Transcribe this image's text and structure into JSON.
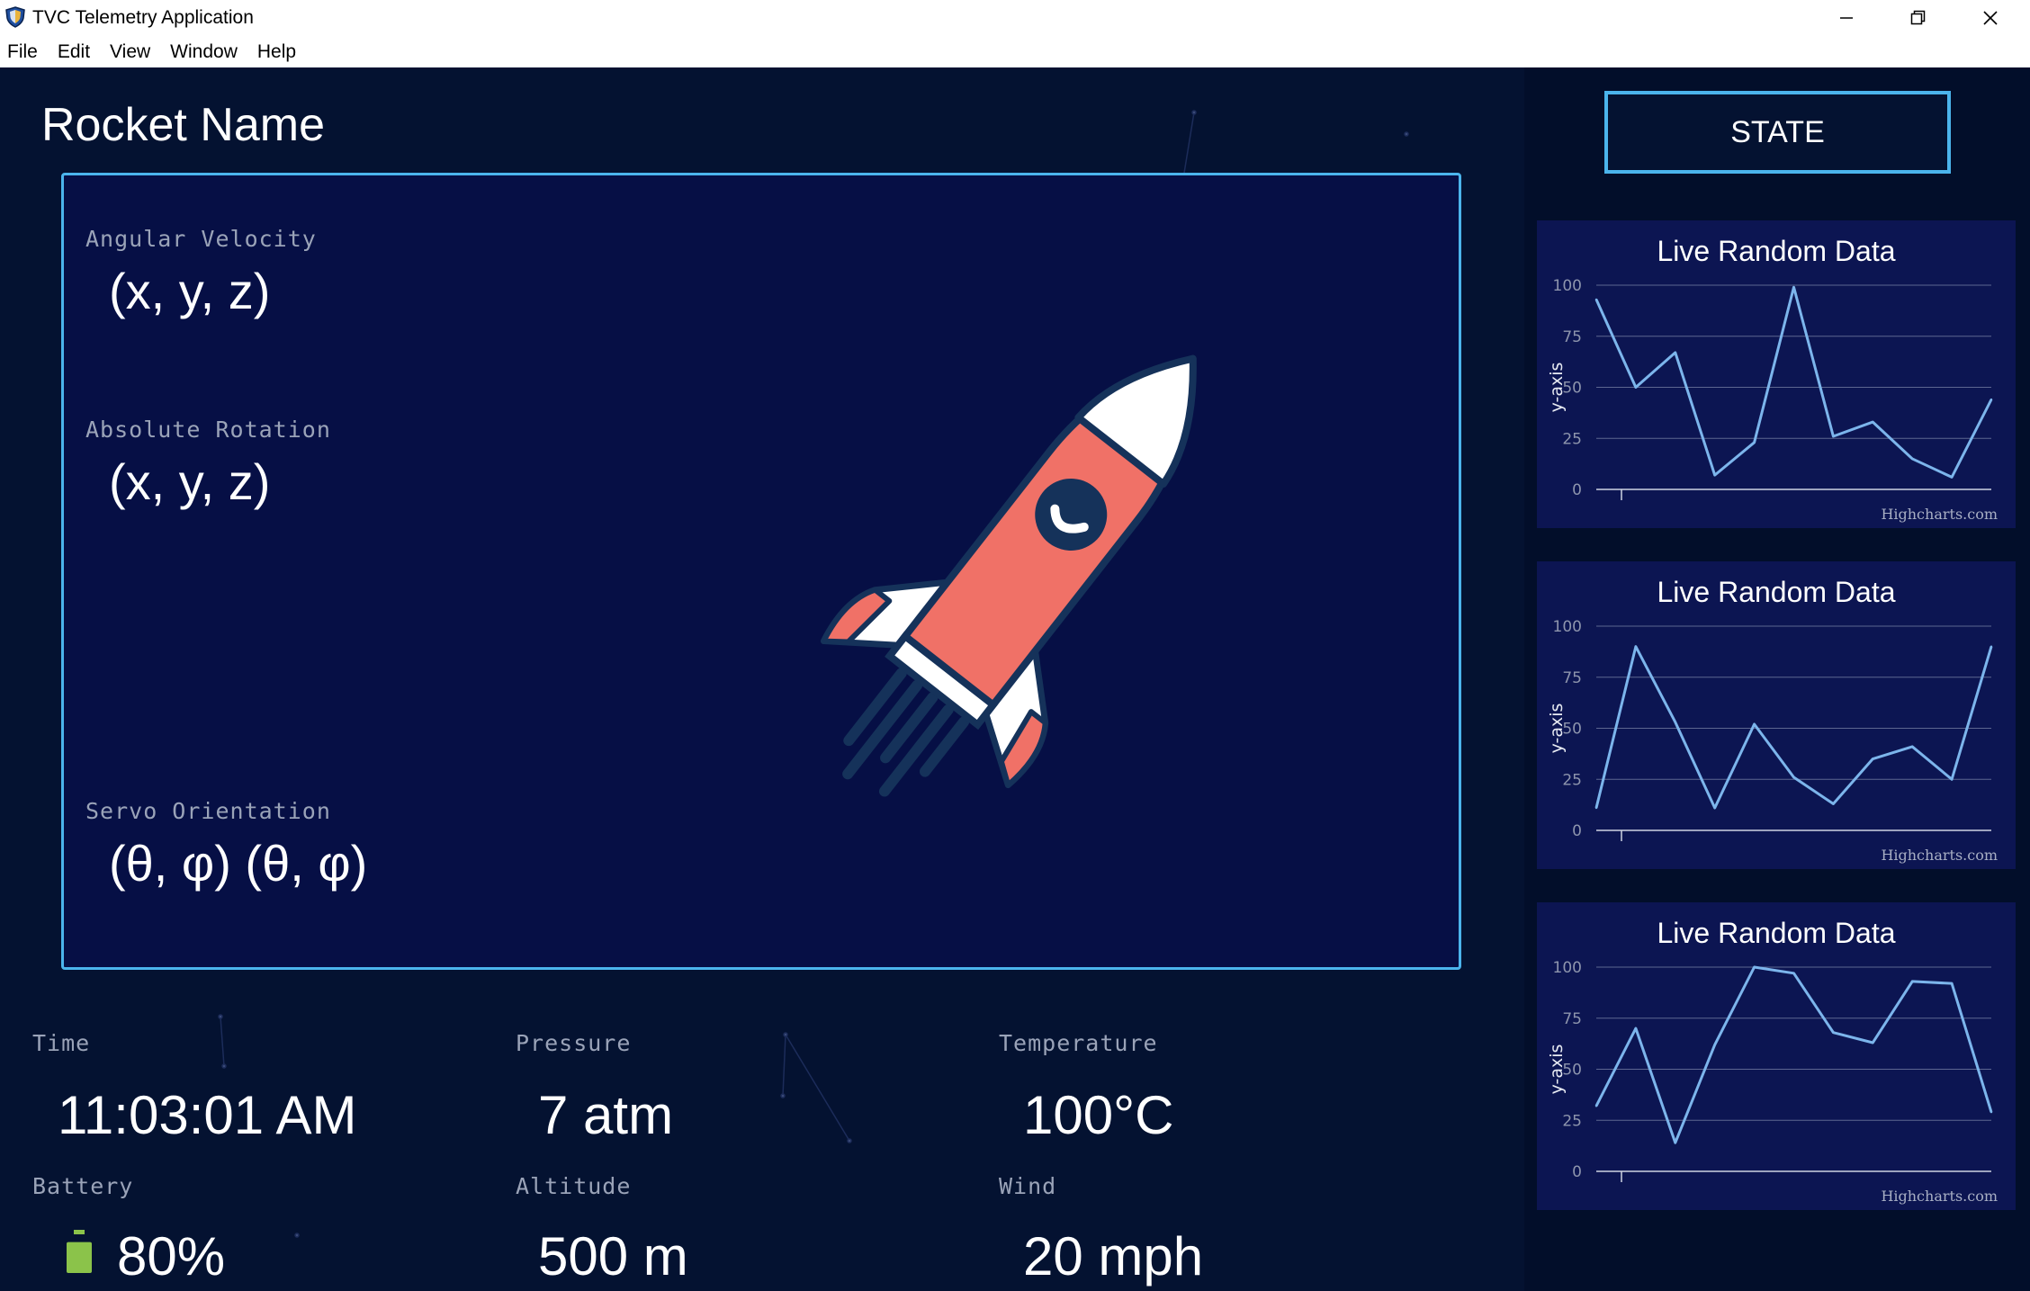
{
  "window": {
    "title": "TVC Telemetry Application",
    "controls": [
      "minimize",
      "restore",
      "close"
    ]
  },
  "menu": {
    "items": [
      "File",
      "Edit",
      "View",
      "Window",
      "Help"
    ]
  },
  "main": {
    "rocket_name": "Rocket Name",
    "panel": {
      "angular_velocity": {
        "label": "Angular Velocity",
        "value": "(x, y, z)"
      },
      "absolute_rotation": {
        "label": "Absolute Rotation",
        "value": "(x, y, z)"
      },
      "servo_orientation": {
        "label": "Servo Orientation",
        "value": "(θ, φ) (θ, φ)"
      }
    },
    "stats": {
      "time": {
        "label": "Time",
        "value": "11:03:01 AM"
      },
      "pressure": {
        "label": "Pressure",
        "value": "7 atm"
      },
      "temperature": {
        "label": "Temperature",
        "value": "100°C"
      },
      "battery": {
        "label": "Battery",
        "value": "80%",
        "level": 0.8
      },
      "altitude": {
        "label": "Altitude",
        "value": "500 m"
      },
      "wind": {
        "label": "Wind",
        "value": "20 mph"
      }
    }
  },
  "sidebar": {
    "state_button": "STATE"
  },
  "colors": {
    "background": "#041231",
    "panel": "#060f45",
    "accent": "#4bb4ec",
    "chart_line": "#7cb5ec",
    "rocket_body": "#f07167",
    "rocket_dark": "#15325a",
    "battery": "#8bc34a"
  },
  "chart_data": [
    {
      "type": "line",
      "title": "Live Random Data",
      "ylabel": "y-axis",
      "ylim": [
        0,
        100
      ],
      "yticks": [
        0,
        25,
        50,
        75,
        100
      ],
      "series": [
        {
          "values": [
            93,
            50,
            67,
            7,
            23,
            99,
            26,
            33,
            15,
            6,
            44
          ]
        }
      ],
      "credit": "Highcharts.com",
      "grid": true
    },
    {
      "type": "line",
      "title": "Live Random Data",
      "ylabel": "y-axis",
      "ylim": [
        0,
        100
      ],
      "yticks": [
        0,
        25,
        50,
        75,
        100
      ],
      "series": [
        {
          "values": [
            11,
            90,
            53,
            11,
            52,
            26,
            13,
            35,
            41,
            25,
            90
          ]
        }
      ],
      "credit": "Highcharts.com",
      "grid": true
    },
    {
      "type": "line",
      "title": "Live Random Data",
      "ylabel": "y-axis",
      "ylim": [
        0,
        100
      ],
      "yticks": [
        0,
        25,
        50,
        75,
        100
      ],
      "series": [
        {
          "values": [
            32,
            70,
            14,
            62,
            100,
            97,
            68,
            63,
            93,
            92,
            29
          ]
        }
      ],
      "credit": "Highcharts.com",
      "grid": true
    }
  ]
}
